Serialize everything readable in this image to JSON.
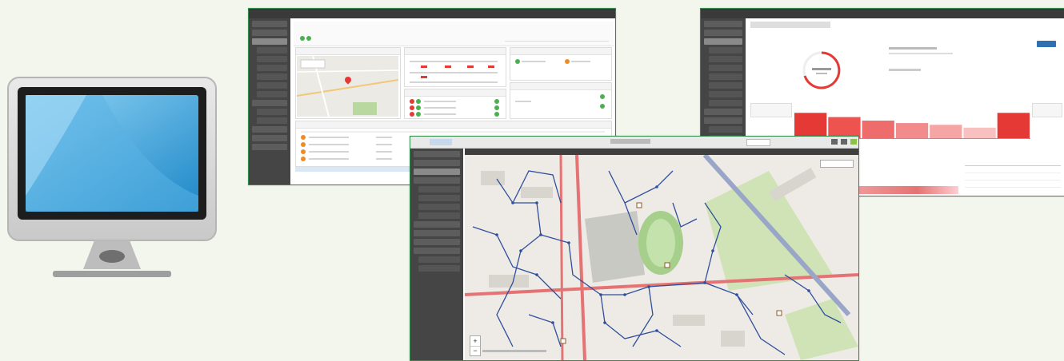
{
  "colors": {
    "background": "#f2f6ec",
    "window_border": "#2f8a4c",
    "sidebar": "#454545",
    "topbar": "#3a3a3a",
    "accent_red": "#e53935",
    "accent_green": "#4caf50",
    "accent_blue": "#2f6fb2"
  },
  "icons": {
    "monitor": "computer-monitor-icon",
    "map_pin": "map-pin-icon",
    "status_dot": "status-dot-icon"
  },
  "chart_data": {
    "type": "bar",
    "values": [
      0.72,
      0.6,
      0.5,
      0.43,
      0.38,
      0.3,
      0.72
    ],
    "ylim": [
      0,
      1
    ],
    "grid": false
  },
  "map": {
    "zoom_plus": "+",
    "zoom_minus": "−"
  }
}
